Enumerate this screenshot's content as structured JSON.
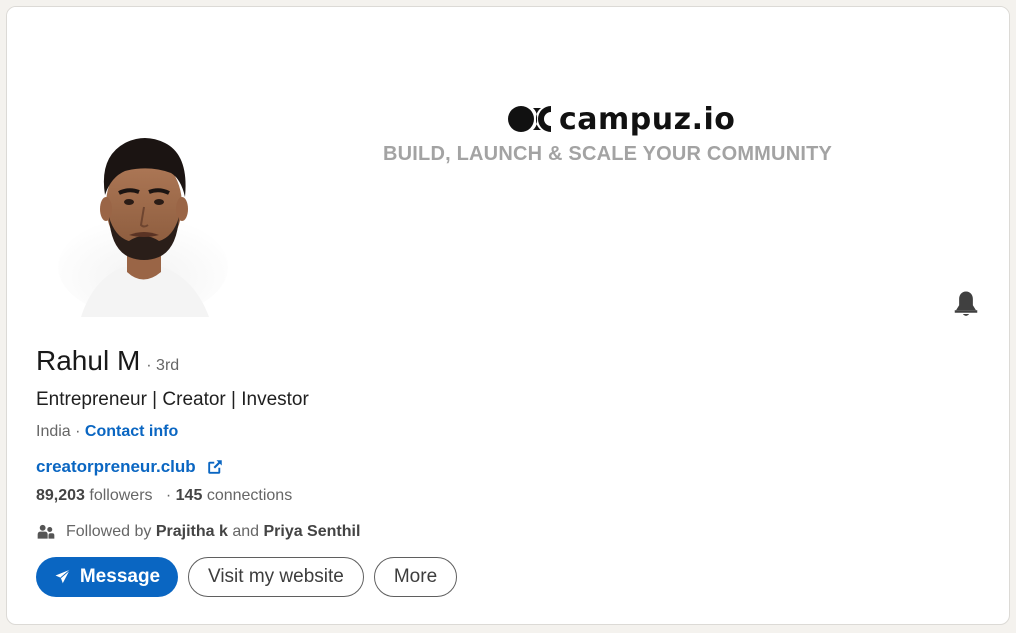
{
  "banner": {
    "brand_name": "campuz.io",
    "tagline": "BUILD, LAUNCH & SCALE YOUR COMMUNITY"
  },
  "profile": {
    "name": "Rahul M",
    "degree": "· 3rd",
    "headline": "Entrepreneur | Creator | Investor",
    "location": "India ·",
    "contact_info_label": "Contact info",
    "website": "creatorpreneur.club",
    "followers_count": "89,203",
    "followers_label": "followers",
    "connections_prefix": "·",
    "connections_count": "145",
    "connections_label": "connections",
    "followed_by_prefix": "Followed by",
    "followed_by_1": "Prajitha k",
    "followed_by_and": "and",
    "followed_by_2": "Priya Senthil"
  },
  "actions": {
    "message_label": "Message",
    "visit_website_label": "Visit my website",
    "more_label": "More"
  },
  "icons": {
    "bell": "bell-icon",
    "send": "paper-plane-icon",
    "external": "external-link-icon",
    "people": "people-icon"
  },
  "colors": {
    "accent": "#0a66c2",
    "text_primary": "#191919",
    "text_secondary": "#666666",
    "tagline_gray": "#a3a3a3"
  }
}
